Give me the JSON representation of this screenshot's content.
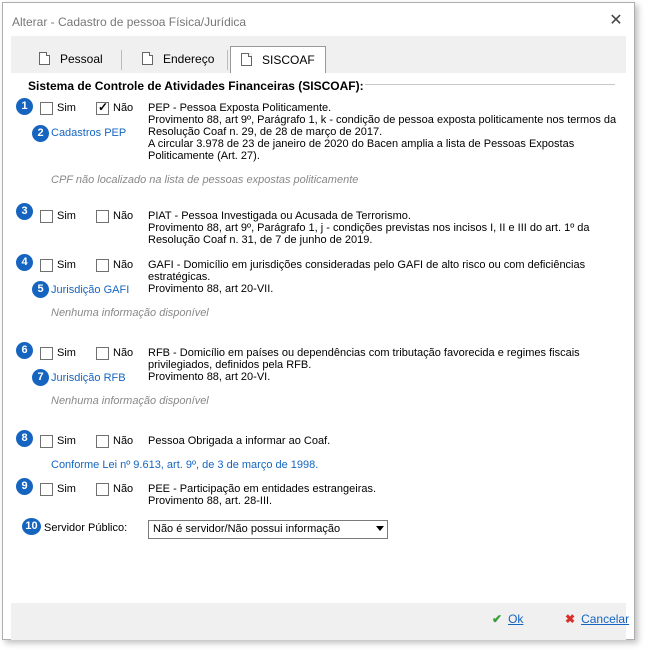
{
  "window": {
    "title": "Alterar - Cadastro de pessoa Física/Jurídica"
  },
  "tabs": [
    {
      "label": "Pessoal"
    },
    {
      "label": "Endereço"
    },
    {
      "label": "SISCOAF"
    }
  ],
  "section_title": "Sistema de Controle de Atividades Financeiras (SISCOAF):",
  "yes_label": "Sim",
  "no_label": "Não",
  "pep": {
    "badge": "1",
    "lines": [
      "PEP - Pessoa Exposta Politicamente.",
      "Provimento 88, art 9º, Parágrafo 1, k - condição de pessoa exposta politicamente nos termos da",
      "Resolução Coaf n. 29, de 28 de março de 2017.",
      "A circular 3.978 de 23 de janeiro de 2020 do Bacen amplia a lista de Pessoas Expostas",
      "Politicamente (Art. 27)."
    ],
    "link_badge": "2",
    "link": "Cadastros PEP",
    "note": "CPF não localizado na lista de pessoas expostas politicamente",
    "yes_checked": false,
    "no_checked": true
  },
  "piat": {
    "badge": "3",
    "lines": [
      "PIAT - Pessoa Investigada ou Acusada de Terrorismo.",
      "Provimento 88, art 9º, Parágrafo 1, j - condições previstas nos incisos I, II e III do art. 1º da",
      "Resolução Coaf n. 31, de 7 de junho de 2019."
    ]
  },
  "gafi": {
    "badge": "4",
    "lines": [
      "GAFI - Domicílio em jurisdições consideradas pelo GAFI de alto risco ou com deficiências",
      "estratégicas.",
      "Provimento 88, art 20-VII."
    ],
    "link_badge": "5",
    "link": "Jurisdição GAFI",
    "note": "Nenhuma informação disponível"
  },
  "rfb": {
    "badge": "6",
    "lines": [
      "RFB - Domicílio em países ou dependências com tributação favorecida e regimes fiscais",
      "privilegiados, definidos pela RFB.",
      "Provimento 88, art 20-VI."
    ],
    "link_badge": "7",
    "link": "Jurisdição RFB",
    "note": "Nenhuma informação disponível"
  },
  "obrigada": {
    "badge": "8",
    "lines": [
      "Pessoa Obrigada a informar ao Coaf."
    ],
    "link": "Conforme Lei nº 9.613, art. 9º, de 3 de março de 1998."
  },
  "pee": {
    "badge": "9",
    "lines": [
      "PEE - Participação em entidades estrangeiras.",
      "Provimento 88, art. 28-III."
    ]
  },
  "servidor": {
    "badge": "10",
    "label": "Servidor Público:",
    "selected": "Não é servidor/Não possui informação"
  },
  "footer": {
    "ok": "Ok",
    "cancel": "Cancelar"
  },
  "colors": {
    "accent": "#1565c0",
    "ok": "#3a9b3a",
    "cancel": "#d9302a"
  }
}
